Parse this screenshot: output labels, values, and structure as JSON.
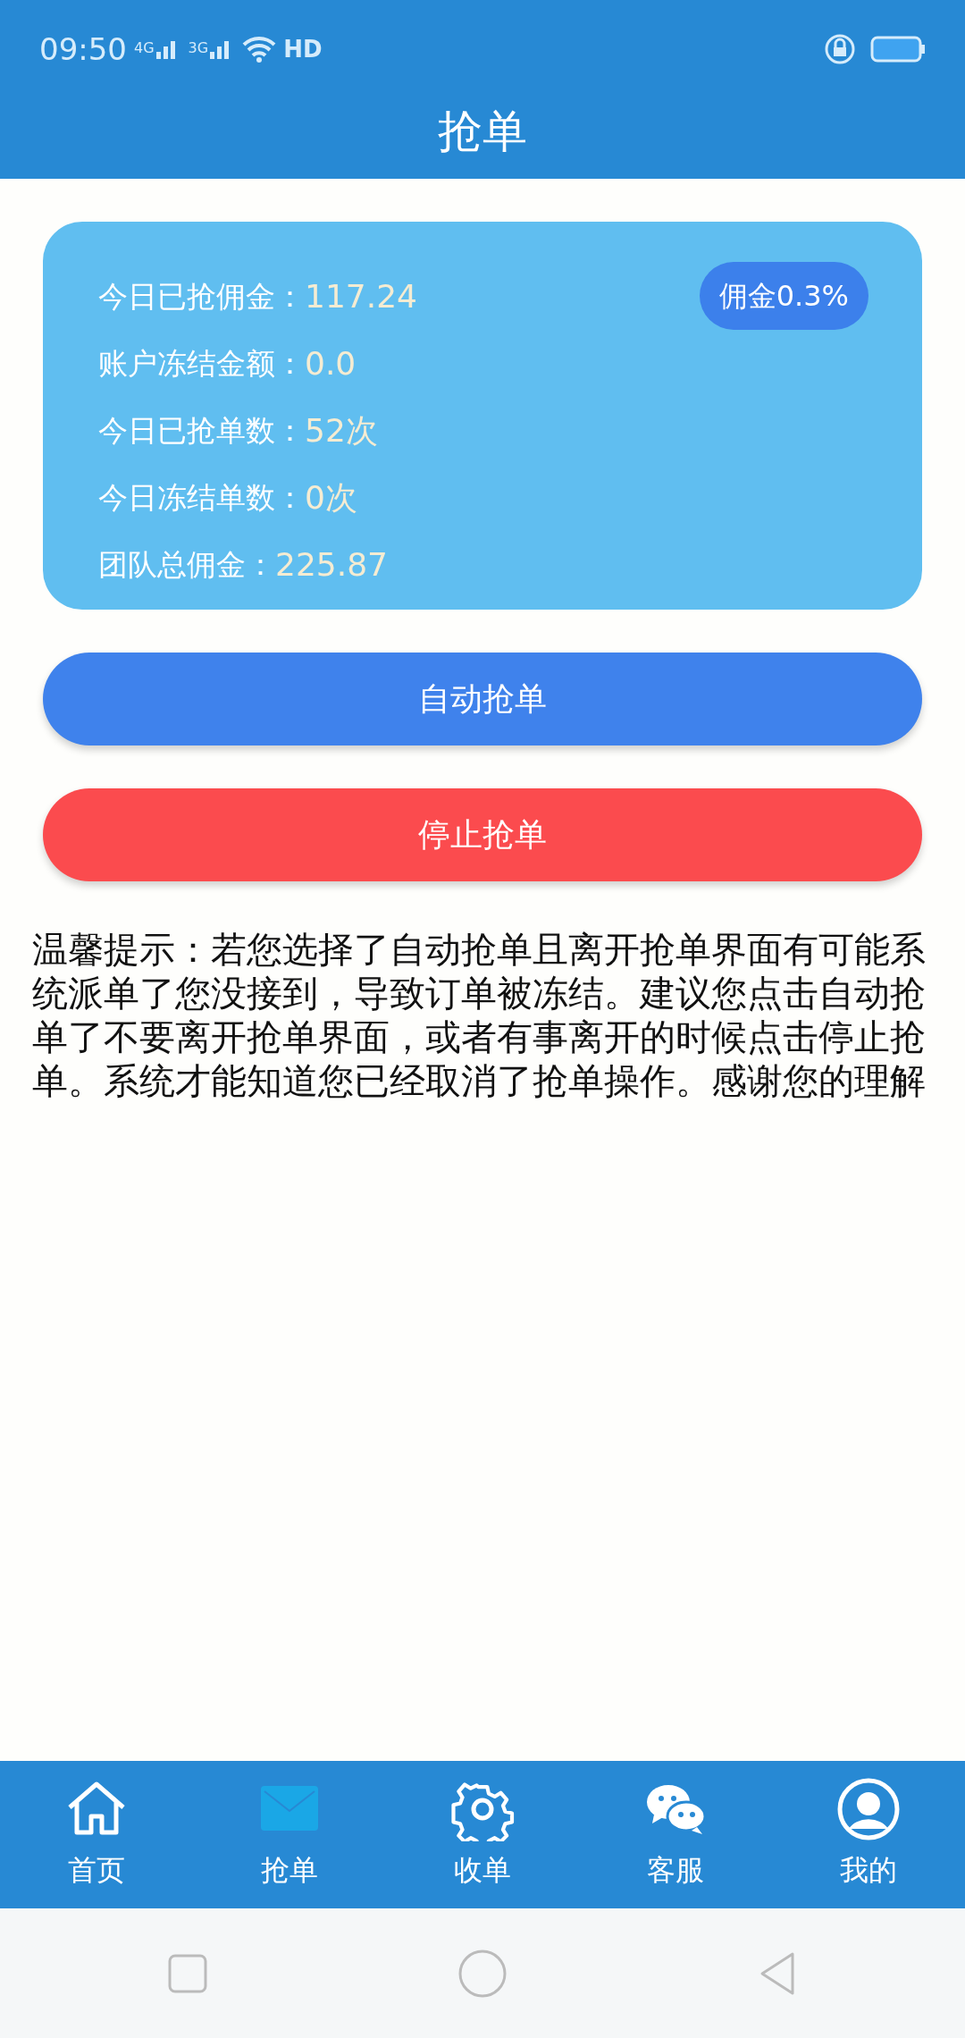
{
  "status_bar": {
    "time": "09:50",
    "network_1": "4G",
    "network_2": "3G",
    "hd": "HD"
  },
  "header": {
    "title": "抢单"
  },
  "stats": [
    {
      "label": "今日已抢佣金：",
      "value": "117.24"
    },
    {
      "label": "账户冻结金额：",
      "value": "0.0"
    },
    {
      "label": "今日已抢单数：",
      "value": "52次"
    },
    {
      "label": "今日冻结单数：",
      "value": "0次"
    },
    {
      "label": "团队总佣金：",
      "value": "225.87"
    }
  ],
  "rate_badge": "佣金0.3%",
  "buttons": [
    {
      "kind": "start",
      "label": "自动抢单"
    },
    {
      "kind": "stop",
      "label": "停止抢单"
    }
  ],
  "notice": "温馨提示：若您选择了自动抢单且离开抢单界面有可能系统派单了您没接到，导致订单被冻结。建议您点击自动抢单了不要离开抢单界面，或者有事离开的时候点击停止抢单。系统才能知道您已经取消了抢单操作。感谢您的理解",
  "tab_bar": [
    {
      "kind": "home",
      "label": "首页",
      "selected": false
    },
    {
      "kind": "mail",
      "label": "抢单",
      "selected": true
    },
    {
      "kind": "gear",
      "label": "收单",
      "selected": false
    },
    {
      "kind": "chat",
      "label": "客服",
      "selected": false
    },
    {
      "kind": "user",
      "label": "我的",
      "selected": false
    }
  ]
}
